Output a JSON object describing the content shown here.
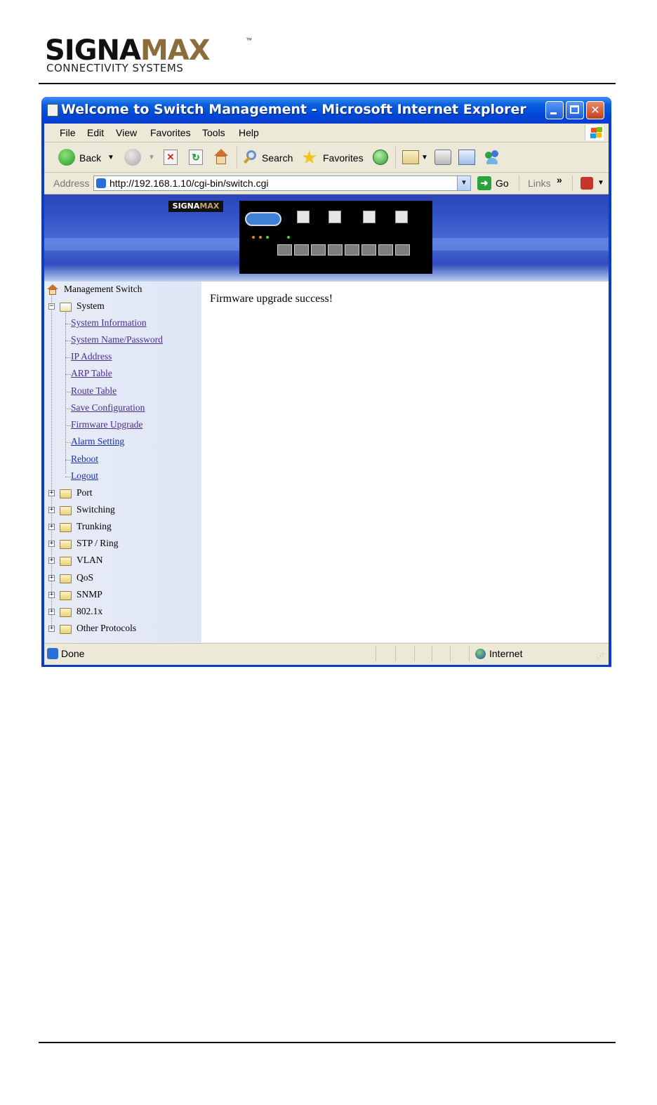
{
  "doc": {
    "logo_main_a": "SIGNA",
    "logo_main_b": "MAX",
    "logo_tm": "™",
    "logo_sub": "CONNECTIVITY SYSTEMS"
  },
  "window": {
    "title": "Welcome to Switch Management - Microsoft Internet Explorer"
  },
  "menubar": [
    "File",
    "Edit",
    "View",
    "Favorites",
    "Tools",
    "Help"
  ],
  "toolbar": {
    "back_label": "Back",
    "search_label": "Search",
    "favorites_label": "Favorites"
  },
  "addressbar": {
    "label": "Address",
    "url": "http://192.168.1.10/cgi-bin/switch.cgi",
    "go_label": "Go",
    "links_label": "Links"
  },
  "banner": {
    "mini_logo_a": "SIGNA",
    "mini_logo_b": "MAX"
  },
  "sidebar": {
    "root": "Management Switch",
    "system": "System",
    "system_items": [
      "System Information",
      "System Name/Password",
      "IP Address",
      "ARP Table",
      "Route Table",
      "Save Configuration",
      "Firmware Upgrade",
      "Alarm Setting",
      "Reboot",
      "Logout"
    ],
    "folders": [
      "Port",
      "Switching",
      "Trunking",
      "STP / Ring",
      "VLAN",
      "QoS",
      "SNMP",
      "802.1x",
      "Other Protocols"
    ]
  },
  "content": {
    "message": "Firmware upgrade success!"
  },
  "statusbar": {
    "status": "Done",
    "zone": "Internet"
  },
  "colors": {
    "titlebar": "#0a3ccc",
    "chrome": "#ece9d8",
    "sidebar_bg": "#e7ecf7",
    "visited_link": "#4a2d8f"
  }
}
